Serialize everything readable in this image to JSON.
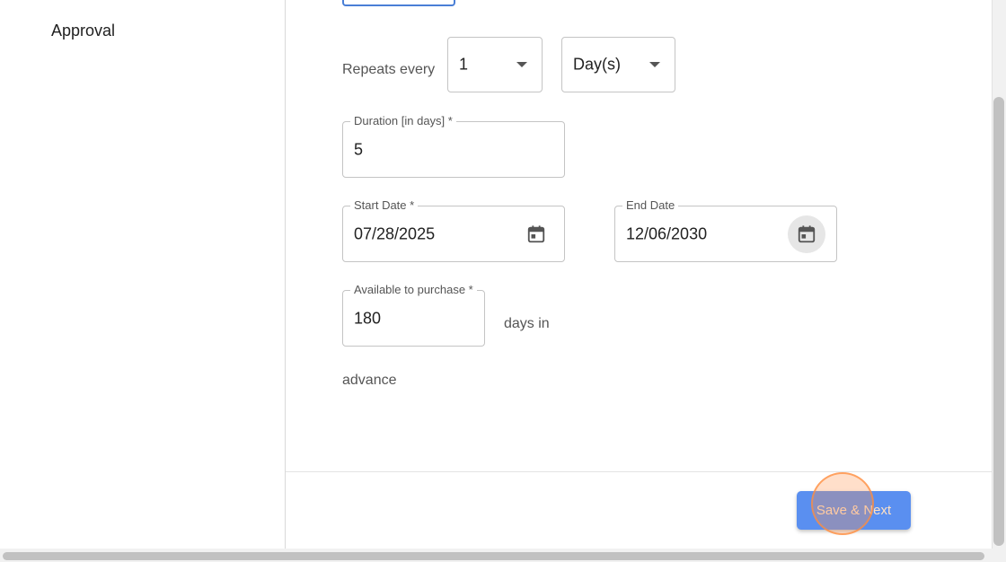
{
  "sidebar": {
    "items": [
      {
        "label": "Approval"
      }
    ]
  },
  "form": {
    "repeats_label": "Repeats every",
    "repeat_count": {
      "value": "1"
    },
    "repeat_unit": {
      "value": "Day(s)"
    },
    "duration": {
      "label": "Duration [in days] *",
      "value": "5"
    },
    "start_date": {
      "label": "Start Date *",
      "value": "07/28/2025"
    },
    "end_date": {
      "label": "End Date",
      "value": "12/06/2030"
    },
    "available": {
      "label": "Available to purchase *",
      "value": "180"
    },
    "days_in_label": "days in",
    "advance_label": "advance"
  },
  "footer": {
    "save_next_label": "Save & Next"
  },
  "icons": {
    "calendar": "calendar-icon",
    "dropdown": "chevron-down-icon"
  },
  "colors": {
    "accent": "#5a8ff0",
    "border": "#c4c4c4"
  }
}
